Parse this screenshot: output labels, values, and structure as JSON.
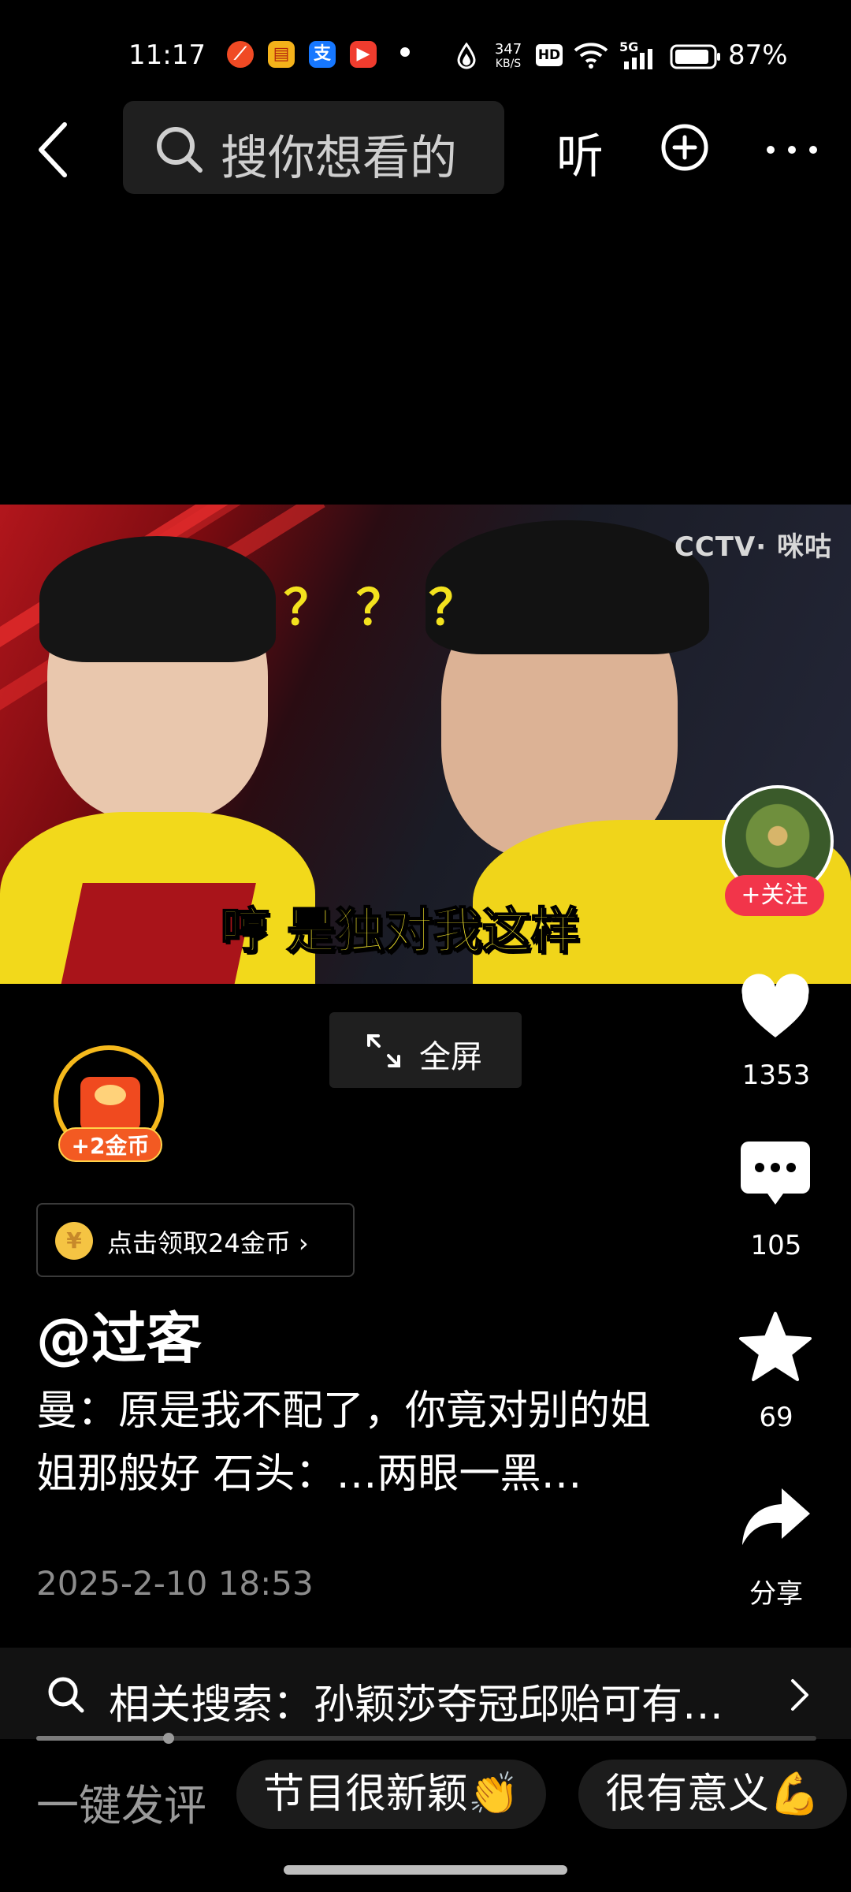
{
  "status_bar": {
    "time": "11:17",
    "net_speed_value": "347",
    "net_speed_unit": "KB/S",
    "hd": "HD",
    "signal": "5G",
    "battery": "87%"
  },
  "nav": {
    "search_placeholder": "搜你想看的",
    "listen_label": "听"
  },
  "video": {
    "watermark": "CCTV· 咪咕",
    "question_marks": "？？？",
    "subtitle": "哼 是独对我这样"
  },
  "fullscreen_label": "全屏",
  "author_actions": {
    "follow_label": "+关注"
  },
  "actions": {
    "likes": "1353",
    "comments": "105",
    "favorites": "69",
    "share_label": "分享"
  },
  "coins": {
    "reward_badge": "+2金币",
    "claim_label": "点击领取24金币 ›"
  },
  "post": {
    "author": "@过客",
    "description": "曼：原是我不配了，你竟对别的姐姐那般好 石头：…两眼一黑…",
    "time": "2025-2-10 18:53"
  },
  "related_search": {
    "text": "相关搜索：孙颖莎夺冠邱贻可有…"
  },
  "progress": {
    "fraction": 0.17
  },
  "quick_comments": {
    "label": "一键发评",
    "chips": [
      "节目很新颖👏",
      "很有意义💪"
    ]
  }
}
